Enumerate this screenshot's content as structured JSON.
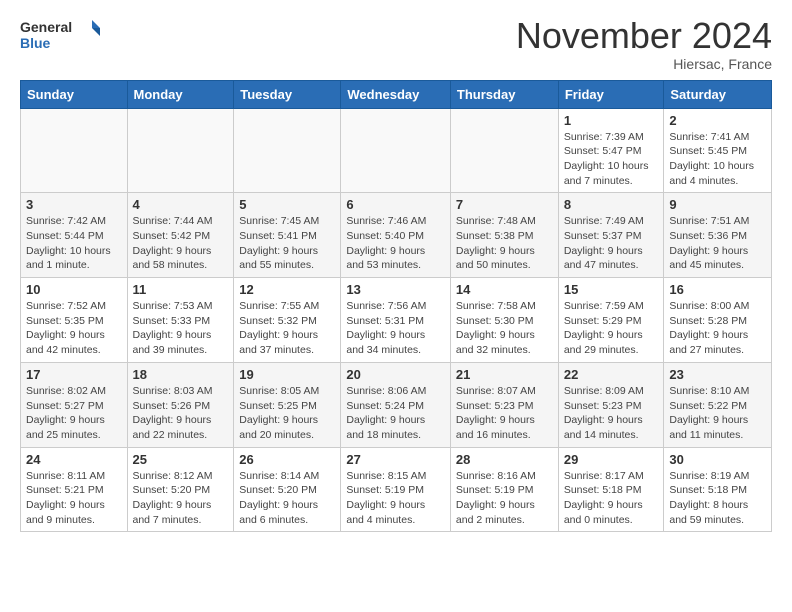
{
  "logo": {
    "line1": "General",
    "line2": "Blue"
  },
  "title": "November 2024",
  "subtitle": "Hiersac, France",
  "headers": [
    "Sunday",
    "Monday",
    "Tuesday",
    "Wednesday",
    "Thursday",
    "Friday",
    "Saturday"
  ],
  "weeks": [
    [
      {
        "day": "",
        "info": ""
      },
      {
        "day": "",
        "info": ""
      },
      {
        "day": "",
        "info": ""
      },
      {
        "day": "",
        "info": ""
      },
      {
        "day": "",
        "info": ""
      },
      {
        "day": "1",
        "info": "Sunrise: 7:39 AM\nSunset: 5:47 PM\nDaylight: 10 hours and 7 minutes."
      },
      {
        "day": "2",
        "info": "Sunrise: 7:41 AM\nSunset: 5:45 PM\nDaylight: 10 hours and 4 minutes."
      }
    ],
    [
      {
        "day": "3",
        "info": "Sunrise: 7:42 AM\nSunset: 5:44 PM\nDaylight: 10 hours and 1 minute."
      },
      {
        "day": "4",
        "info": "Sunrise: 7:44 AM\nSunset: 5:42 PM\nDaylight: 9 hours and 58 minutes."
      },
      {
        "day": "5",
        "info": "Sunrise: 7:45 AM\nSunset: 5:41 PM\nDaylight: 9 hours and 55 minutes."
      },
      {
        "day": "6",
        "info": "Sunrise: 7:46 AM\nSunset: 5:40 PM\nDaylight: 9 hours and 53 minutes."
      },
      {
        "day": "7",
        "info": "Sunrise: 7:48 AM\nSunset: 5:38 PM\nDaylight: 9 hours and 50 minutes."
      },
      {
        "day": "8",
        "info": "Sunrise: 7:49 AM\nSunset: 5:37 PM\nDaylight: 9 hours and 47 minutes."
      },
      {
        "day": "9",
        "info": "Sunrise: 7:51 AM\nSunset: 5:36 PM\nDaylight: 9 hours and 45 minutes."
      }
    ],
    [
      {
        "day": "10",
        "info": "Sunrise: 7:52 AM\nSunset: 5:35 PM\nDaylight: 9 hours and 42 minutes."
      },
      {
        "day": "11",
        "info": "Sunrise: 7:53 AM\nSunset: 5:33 PM\nDaylight: 9 hours and 39 minutes."
      },
      {
        "day": "12",
        "info": "Sunrise: 7:55 AM\nSunset: 5:32 PM\nDaylight: 9 hours and 37 minutes."
      },
      {
        "day": "13",
        "info": "Sunrise: 7:56 AM\nSunset: 5:31 PM\nDaylight: 9 hours and 34 minutes."
      },
      {
        "day": "14",
        "info": "Sunrise: 7:58 AM\nSunset: 5:30 PM\nDaylight: 9 hours and 32 minutes."
      },
      {
        "day": "15",
        "info": "Sunrise: 7:59 AM\nSunset: 5:29 PM\nDaylight: 9 hours and 29 minutes."
      },
      {
        "day": "16",
        "info": "Sunrise: 8:00 AM\nSunset: 5:28 PM\nDaylight: 9 hours and 27 minutes."
      }
    ],
    [
      {
        "day": "17",
        "info": "Sunrise: 8:02 AM\nSunset: 5:27 PM\nDaylight: 9 hours and 25 minutes."
      },
      {
        "day": "18",
        "info": "Sunrise: 8:03 AM\nSunset: 5:26 PM\nDaylight: 9 hours and 22 minutes."
      },
      {
        "day": "19",
        "info": "Sunrise: 8:05 AM\nSunset: 5:25 PM\nDaylight: 9 hours and 20 minutes."
      },
      {
        "day": "20",
        "info": "Sunrise: 8:06 AM\nSunset: 5:24 PM\nDaylight: 9 hours and 18 minutes."
      },
      {
        "day": "21",
        "info": "Sunrise: 8:07 AM\nSunset: 5:23 PM\nDaylight: 9 hours and 16 minutes."
      },
      {
        "day": "22",
        "info": "Sunrise: 8:09 AM\nSunset: 5:23 PM\nDaylight: 9 hours and 14 minutes."
      },
      {
        "day": "23",
        "info": "Sunrise: 8:10 AM\nSunset: 5:22 PM\nDaylight: 9 hours and 11 minutes."
      }
    ],
    [
      {
        "day": "24",
        "info": "Sunrise: 8:11 AM\nSunset: 5:21 PM\nDaylight: 9 hours and 9 minutes."
      },
      {
        "day": "25",
        "info": "Sunrise: 8:12 AM\nSunset: 5:20 PM\nDaylight: 9 hours and 7 minutes."
      },
      {
        "day": "26",
        "info": "Sunrise: 8:14 AM\nSunset: 5:20 PM\nDaylight: 9 hours and 6 minutes."
      },
      {
        "day": "27",
        "info": "Sunrise: 8:15 AM\nSunset: 5:19 PM\nDaylight: 9 hours and 4 minutes."
      },
      {
        "day": "28",
        "info": "Sunrise: 8:16 AM\nSunset: 5:19 PM\nDaylight: 9 hours and 2 minutes."
      },
      {
        "day": "29",
        "info": "Sunrise: 8:17 AM\nSunset: 5:18 PM\nDaylight: 9 hours and 0 minutes."
      },
      {
        "day": "30",
        "info": "Sunrise: 8:19 AM\nSunset: 5:18 PM\nDaylight: 8 hours and 59 minutes."
      }
    ]
  ]
}
